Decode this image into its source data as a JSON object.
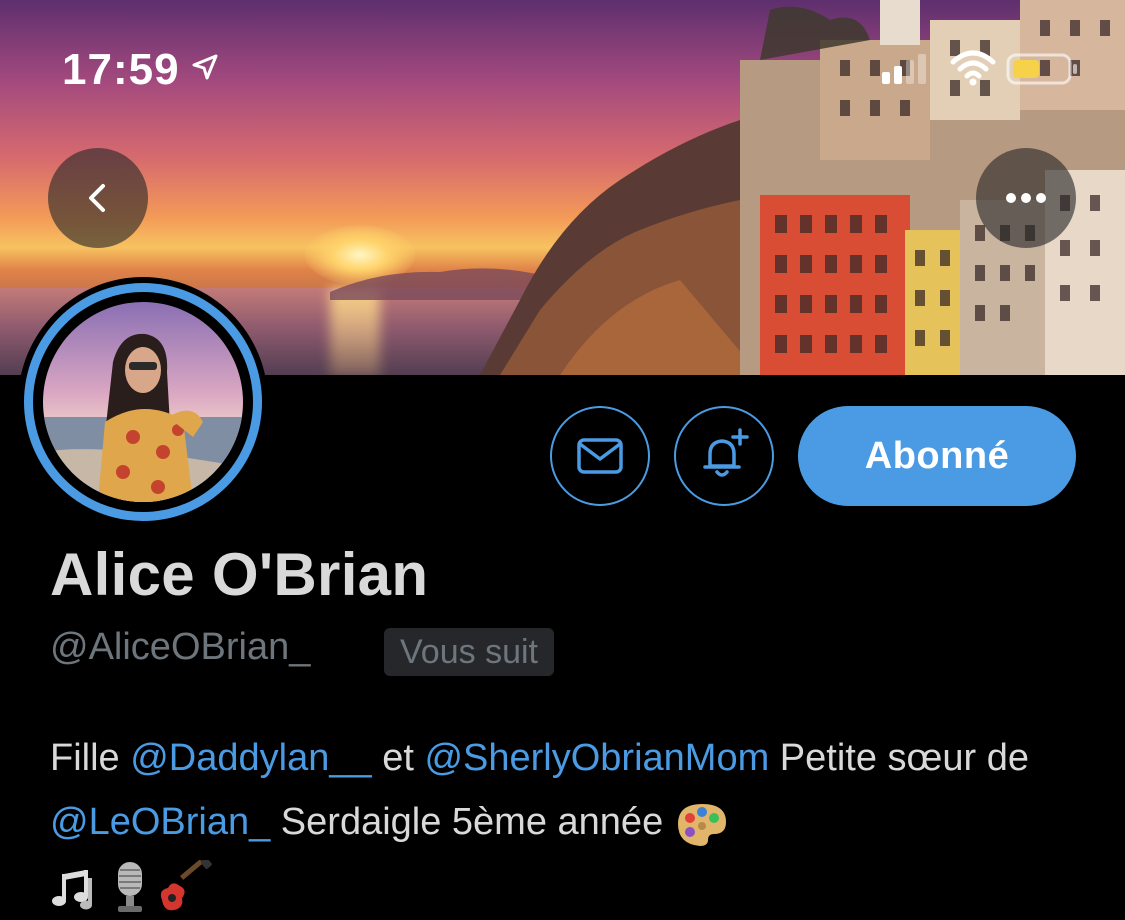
{
  "status_bar": {
    "time": "17:59",
    "icons": [
      "location-arrow-icon",
      "cellular-signal-icon",
      "wifi-icon",
      "battery-icon"
    ],
    "battery_color": "#f5d24a"
  },
  "nav": {
    "back_icon": "chevron-left-icon",
    "more_icon": "more-horizontal-icon"
  },
  "profile": {
    "display_name": "Alice O'Brian",
    "handle": "@AliceOBrian_",
    "follows_you_badge": "Vous suit",
    "avatar_ring_color": "#4a9be3"
  },
  "actions": {
    "message_icon": "envelope-icon",
    "notify_icon": "bell-plus-icon",
    "follow_label": "Abonné",
    "accent_color": "#4a9be3"
  },
  "bio": {
    "t1": "Fille ",
    "m1": "@Daddylan__",
    "t2": " et ",
    "m2": "@SherlyObrianMom",
    "t3": " Petite sœur de ",
    "m3": "@LeOBrian_",
    "t4": " Serdaigle 5ème année ",
    "emojis": [
      "palette-emoji",
      "musical-notes-emoji",
      "microphone-emoji",
      "guitar-emoji"
    ]
  }
}
